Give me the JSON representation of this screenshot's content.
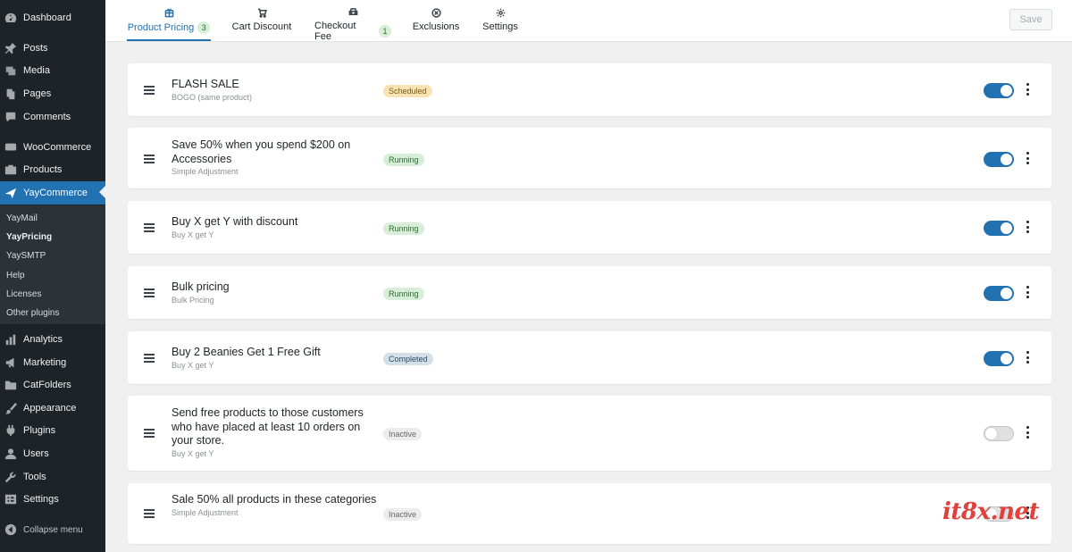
{
  "sidebar": {
    "items": [
      {
        "label": "Dashboard",
        "icon": "dashboard-icon"
      },
      {
        "label": "Posts",
        "icon": "pin-icon"
      },
      {
        "label": "Media",
        "icon": "media-icon"
      },
      {
        "label": "Pages",
        "icon": "pages-icon"
      },
      {
        "label": "Comments",
        "icon": "comment-icon"
      },
      {
        "label": "WooCommerce",
        "icon": "woo-icon"
      },
      {
        "label": "Products",
        "icon": "products-icon"
      },
      {
        "label": "YayCommerce",
        "icon": "yay-icon"
      },
      {
        "label": "Analytics",
        "icon": "chart-icon"
      },
      {
        "label": "Marketing",
        "icon": "megaphone-icon"
      },
      {
        "label": "CatFolders",
        "icon": "folder-icon"
      },
      {
        "label": "Appearance",
        "icon": "brush-icon"
      },
      {
        "label": "Plugins",
        "icon": "plugin-icon"
      },
      {
        "label": "Users",
        "icon": "user-icon"
      },
      {
        "label": "Tools",
        "icon": "wrench-icon"
      },
      {
        "label": "Settings",
        "icon": "settings-icon"
      }
    ],
    "submenu": [
      "YayMail",
      "YayPricing",
      "YaySMTP",
      "Help",
      "Licenses",
      "Other plugins"
    ],
    "collapse_label": "Collapse menu"
  },
  "tabs": [
    {
      "label": "Product Pricing",
      "badge": "3",
      "icon": "tag-icon"
    },
    {
      "label": "Cart Discount",
      "badge": "",
      "icon": "cart-icon"
    },
    {
      "label": "Checkout Fee",
      "badge": "1",
      "icon": "car-icon"
    },
    {
      "label": "Exclusions",
      "badge": "",
      "icon": "circle-x-icon"
    },
    {
      "label": "Settings",
      "badge": "",
      "icon": "gear-icon"
    }
  ],
  "toolbar": {
    "save_label": "Save"
  },
  "rules": [
    {
      "title": "FLASH SALE",
      "type": "BOGO (same product)",
      "status": "Scheduled",
      "enabled": true
    },
    {
      "title": "Save 50% when you spend $200 on Accessories",
      "type": "Simple Adjustment",
      "status": "Running",
      "enabled": true
    },
    {
      "title": "Buy X get Y with discount",
      "type": "Buy X get Y",
      "status": "Running",
      "enabled": true
    },
    {
      "title": "Bulk pricing",
      "type": "Bulk Pricing",
      "status": "Running",
      "enabled": true
    },
    {
      "title": "Buy 2 Beanies Get 1 Free Gift",
      "type": "Buy X get Y",
      "status": "Completed",
      "enabled": true
    },
    {
      "title": "Send free products to those customers who have placed at least 10 orders on your store.",
      "type": "Buy X get Y",
      "status": "Inactive",
      "enabled": false
    },
    {
      "title": "Sale 50% all products in these categories",
      "type": "Simple Adjustment",
      "status": "Inactive",
      "enabled": false
    }
  ],
  "watermark": "it8x.net"
}
